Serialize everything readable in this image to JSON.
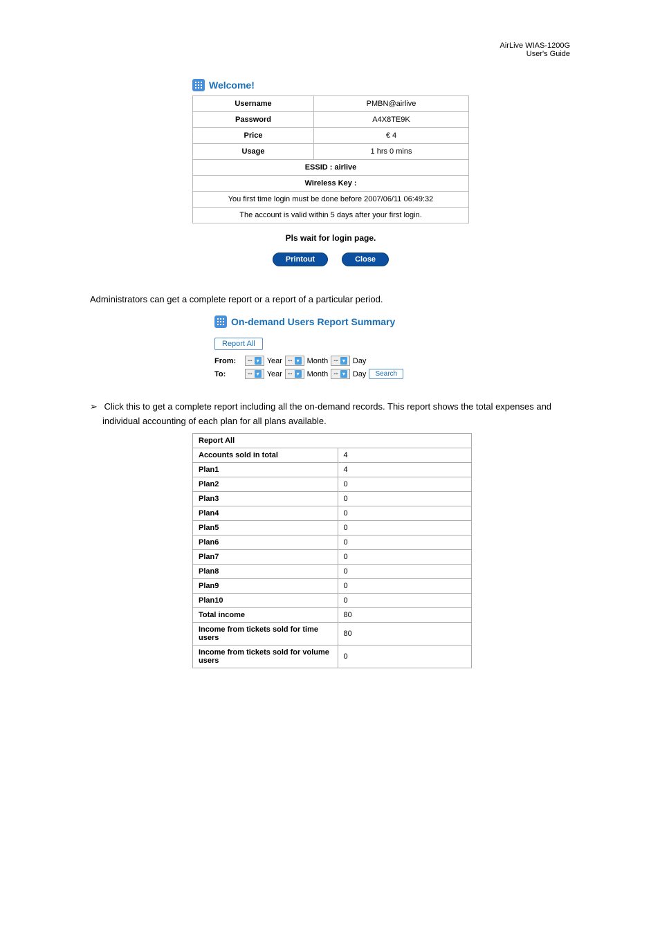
{
  "header": {
    "product": "AirLive WIAS-1200G",
    "doc": "User's Guide"
  },
  "welcome": {
    "title": "Welcome!",
    "rows": {
      "username_label": "Username",
      "username_value": "PMBN@airlive",
      "password_label": "Password",
      "password_value": "A4X8TE9K",
      "price_label": "Price",
      "price_value": "€ 4",
      "usage_label": "Usage",
      "usage_value": "1 hrs 0 mins",
      "essid": "ESSID : airlive",
      "wkey": "Wireless Key :",
      "first_login": "You first time login must be done before 2007/06/11 06:49:32",
      "valid": "The account is valid within 5 days after your first login."
    },
    "wait": "Pls wait for login page.",
    "printout": "Printout",
    "close": "Close"
  },
  "admin_text": "Administrators can get a complete report or a report of a particular period.",
  "summary": {
    "title": "On-demand Users Report Summary",
    "report_all": "Report All",
    "from": "From:",
    "to": "To:",
    "year": "Year",
    "month": "Month",
    "day": "Day",
    "dash": "--",
    "search": "Search"
  },
  "para": {
    "arrow": "➢",
    "text": "Click this to get a complete report including all the on-demand records. This report shows the total expenses and individual accounting of each plan for all plans available."
  },
  "report_table": {
    "title": "Report All",
    "rows": [
      {
        "k": "Accounts sold in total",
        "v": "4"
      },
      {
        "k": "Plan1",
        "v": "4"
      },
      {
        "k": "Plan2",
        "v": "0"
      },
      {
        "k": "Plan3",
        "v": "0"
      },
      {
        "k": "Plan4",
        "v": "0"
      },
      {
        "k": "Plan5",
        "v": "0"
      },
      {
        "k": "Plan6",
        "v": "0"
      },
      {
        "k": "Plan7",
        "v": "0"
      },
      {
        "k": "Plan8",
        "v": "0"
      },
      {
        "k": "Plan9",
        "v": "0"
      },
      {
        "k": "Plan10",
        "v": "0"
      },
      {
        "k": "Total income",
        "v": "80"
      },
      {
        "k": "Income from tickets sold for time users",
        "v": "80"
      },
      {
        "k": "Income from tickets sold for volume users",
        "v": "0"
      }
    ]
  }
}
